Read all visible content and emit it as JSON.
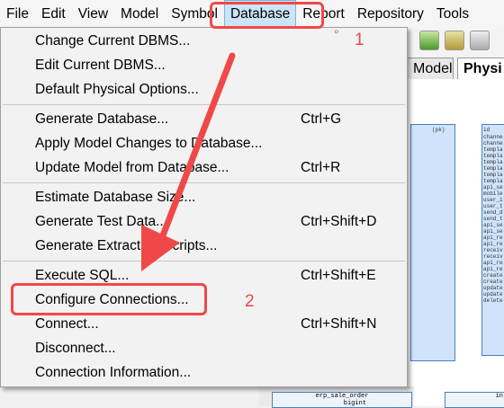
{
  "menubar": {
    "items": [
      "File",
      "Edit",
      "View",
      "Model",
      "Symbol",
      "Database",
      "Report",
      "Repository",
      "Tools"
    ],
    "active": "Database"
  },
  "tabs": {
    "model": "Model",
    "physical": "Physi"
  },
  "menu": {
    "group1": [
      {
        "label": "Change Current DBMS...",
        "shortcut": ""
      },
      {
        "label": "Edit Current DBMS...",
        "shortcut": ""
      },
      {
        "label": "Default Physical Options...",
        "shortcut": ""
      }
    ],
    "group2": [
      {
        "label": "Generate Database...",
        "shortcut": "Ctrl+G"
      },
      {
        "label": "Apply Model Changes to Database...",
        "shortcut": ""
      },
      {
        "label": "Update Model from Database...",
        "shortcut": "Ctrl+R"
      }
    ],
    "group3": [
      {
        "label": "Estimate Database Size...",
        "shortcut": ""
      },
      {
        "label": "Generate Test Data...",
        "shortcut": "Ctrl+Shift+D"
      },
      {
        "label": "Generate Extraction Scripts...",
        "shortcut": ""
      }
    ],
    "group4": [
      {
        "label": "Execute SQL...",
        "shortcut": "Ctrl+Shift+E"
      },
      {
        "label": "Configure Connections...",
        "shortcut": ""
      },
      {
        "label": "Connect...",
        "shortcut": "Ctrl+Shift+N"
      },
      {
        "label": "Disconnect...",
        "shortcut": ""
      },
      {
        "label": "Connection Information...",
        "shortcut": ""
      }
    ]
  },
  "canvas": {
    "pk_label": "(pk)",
    "id_label": "id",
    "right_fields": [
      "channe",
      "channe",
      "templa",
      "templa",
      "templa",
      "templa",
      "templa",
      "templa",
      "api_se",
      "mobile",
      "user_i",
      "user_t",
      "send_d",
      "send_t",
      "api_se",
      "api_se",
      "api_re",
      "api_re",
      "receiv",
      "receiv",
      "api_re",
      "api_re",
      "create",
      "create",
      "update",
      "update",
      "delete"
    ],
    "bottom_table": "erp_sale_order",
    "bottom_field": "bigint",
    "bottom_right": "in"
  },
  "annotations": {
    "step1": "1",
    "step2": "2",
    "color": "#f04848"
  }
}
